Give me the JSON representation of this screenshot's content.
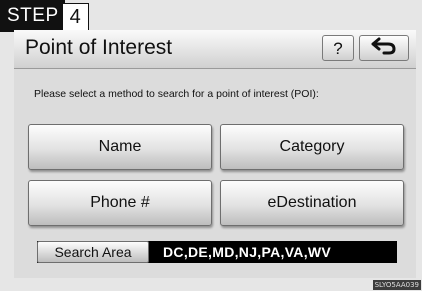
{
  "step": {
    "label": "STEP",
    "number": "4"
  },
  "header": {
    "title": "Point of Interest",
    "help_label": "?"
  },
  "instruction": "Please select a method to search for a point of interest (POI):",
  "buttons": {
    "name": "Name",
    "category": "Category",
    "phone": "Phone #",
    "edestination": "eDestination"
  },
  "search_area": {
    "label": "Search Area",
    "value": "DC,DE,MD,NJ,PA,VA,WV"
  },
  "image_code": "SLYO5AA039",
  "icons": {
    "back": "back-arrow-icon"
  },
  "colors": {
    "background": "#e6e6e6",
    "badge": "#111111",
    "search_area_bar": "#000000"
  }
}
